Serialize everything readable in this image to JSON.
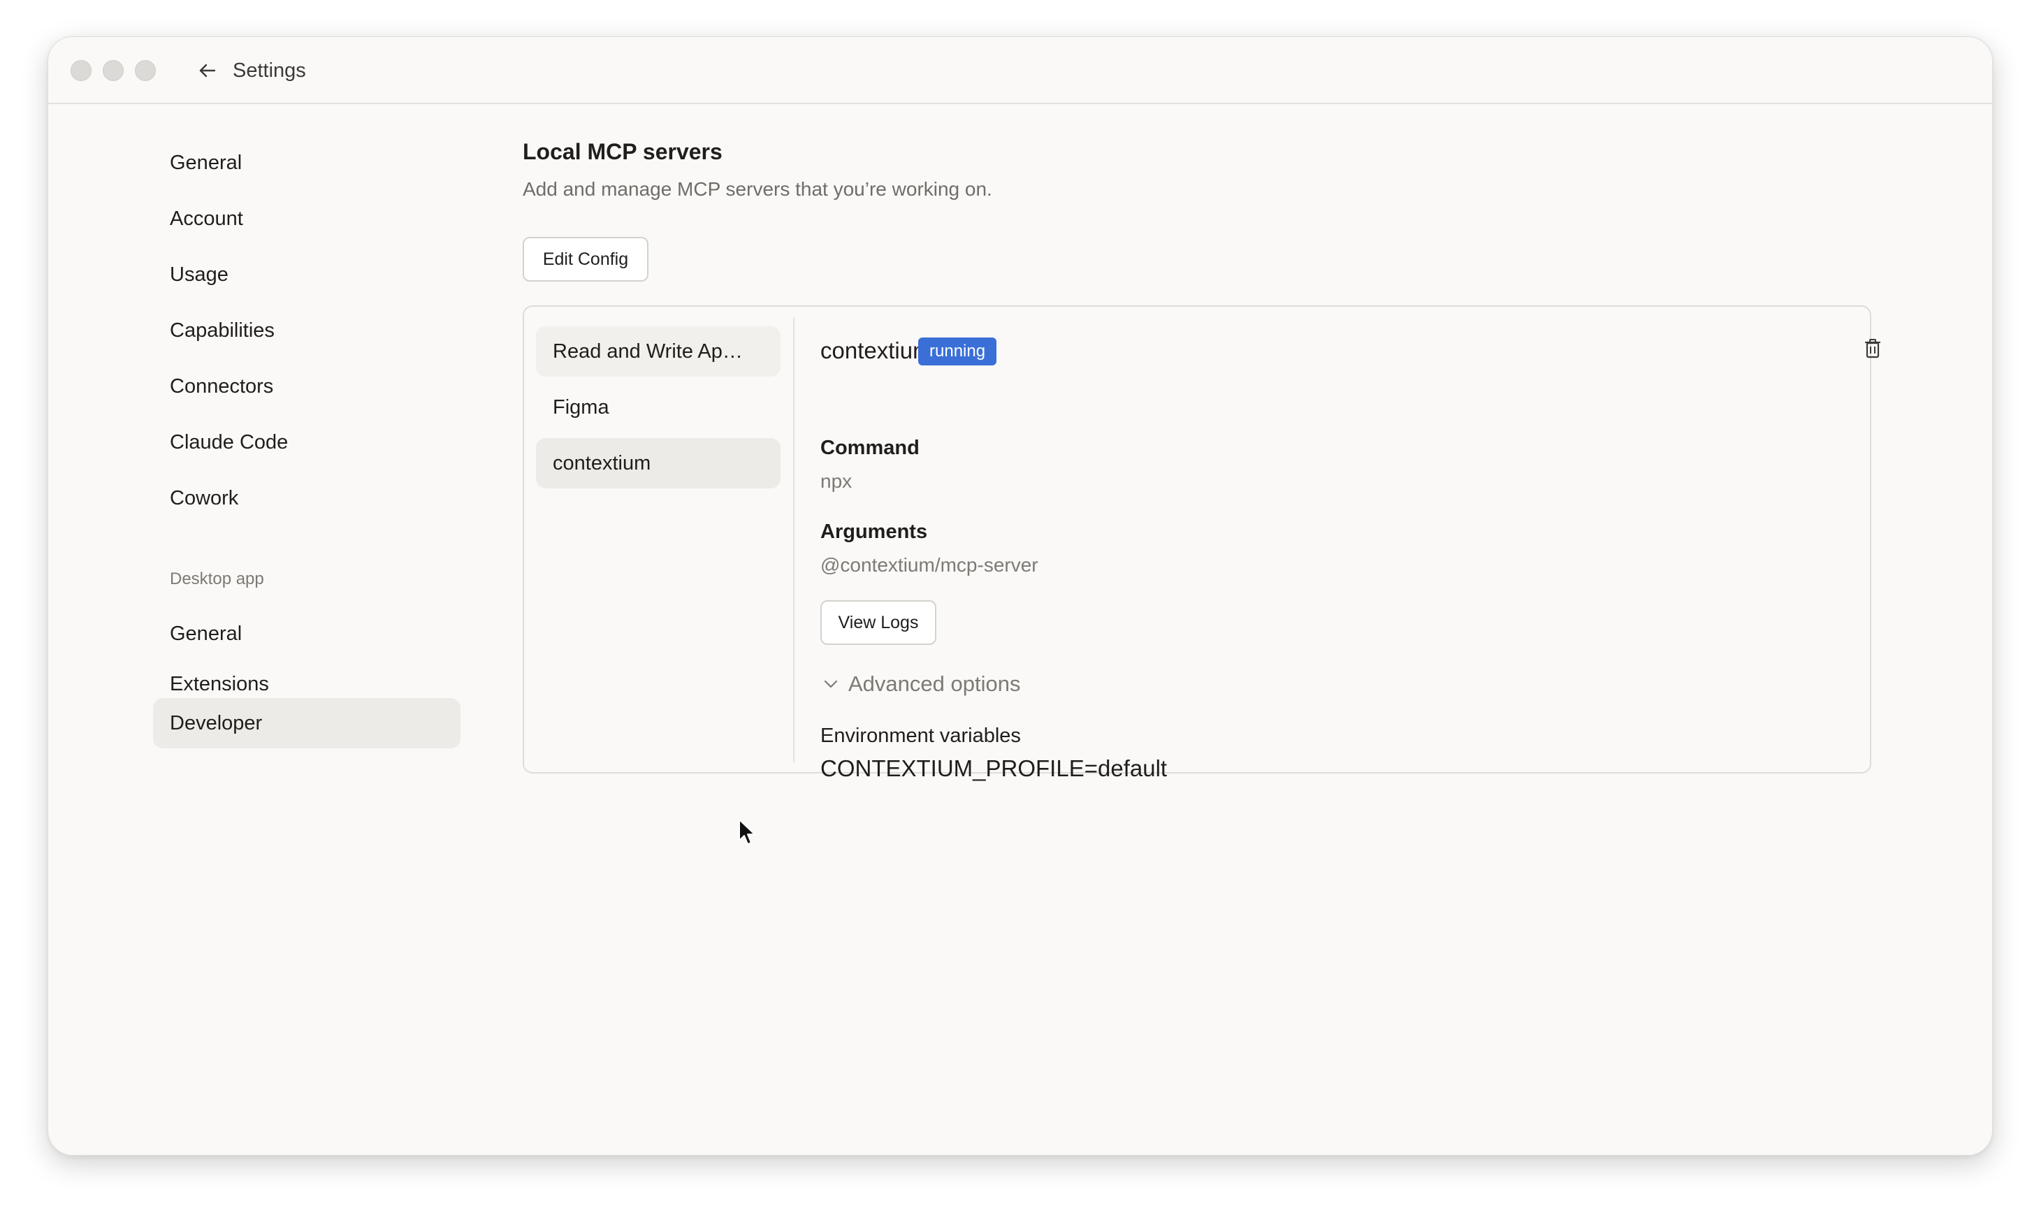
{
  "window": {
    "title": "Settings"
  },
  "sidebar": {
    "items": [
      {
        "label": "General"
      },
      {
        "label": "Account"
      },
      {
        "label": "Usage"
      },
      {
        "label": "Capabilities"
      },
      {
        "label": "Connectors"
      },
      {
        "label": "Claude Code"
      },
      {
        "label": "Cowork"
      }
    ],
    "desktop_section_label": "Desktop app",
    "desktop_items": [
      {
        "label": "General"
      },
      {
        "label": "Extensions"
      },
      {
        "label": "Developer",
        "active": true
      }
    ]
  },
  "main": {
    "title": "Local MCP servers",
    "subtitle": "Add and manage MCP servers that you’re working on.",
    "edit_config_label": "Edit Config",
    "servers": [
      {
        "label": "Read and Write Ap…"
      },
      {
        "label": "Figma"
      },
      {
        "label": "contextium",
        "active": true
      }
    ],
    "detail": {
      "name": "contextium",
      "status": "running",
      "status_color": "#3a6fd8",
      "command_label": "Command",
      "command_value": "npx",
      "arguments_label": "Arguments",
      "arguments_value": "@contextium/mcp-server",
      "view_logs_label": "View Logs",
      "advanced_label": "Advanced options",
      "env_label": "Environment variables",
      "env_value": "CONTEXTIUM_PROFILE=default",
      "delete_icon": "trash-icon"
    }
  }
}
